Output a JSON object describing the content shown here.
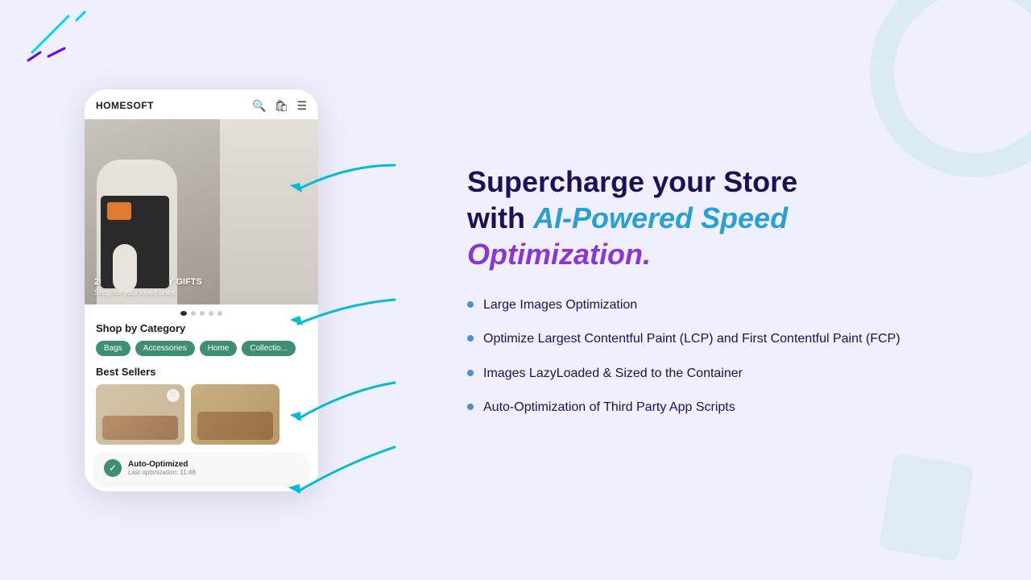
{
  "left": {
    "phone": {
      "logo": "HOMESOFT",
      "hero": {
        "discount_label": "20% OFF HOLIDAY GIFTS",
        "discount_sub": "Shop for your loved ones"
      },
      "categories_title": "Shop by Category",
      "categories": [
        "Bags",
        "Accessories",
        "Home",
        "Collectio..."
      ],
      "best_sellers_title": "Best Sellers",
      "auto_opt": {
        "label": "Auto-Optimized",
        "sub": "Last optimization: 11:48"
      }
    }
  },
  "right": {
    "heading_part1": "Supercharge your Store",
    "heading_part2": "with ",
    "heading_highlight_blue": "AI-Powered Speed",
    "heading_part3": "",
    "heading_highlight_purple": "Optimization.",
    "features": [
      {
        "text": "Large Images Optimization"
      },
      {
        "text": "Optimize Largest Contentful Paint (LCP) and First Contentful Paint (FCP)"
      },
      {
        "text": "Images LazyLoaded & Sized to the Container"
      },
      {
        "text": "Auto-Optimization of Third Party App Scripts"
      }
    ]
  },
  "icons": {
    "search": "🔍",
    "bag": "🛍",
    "menu": "☰",
    "heart": "♡",
    "check": "✓"
  }
}
